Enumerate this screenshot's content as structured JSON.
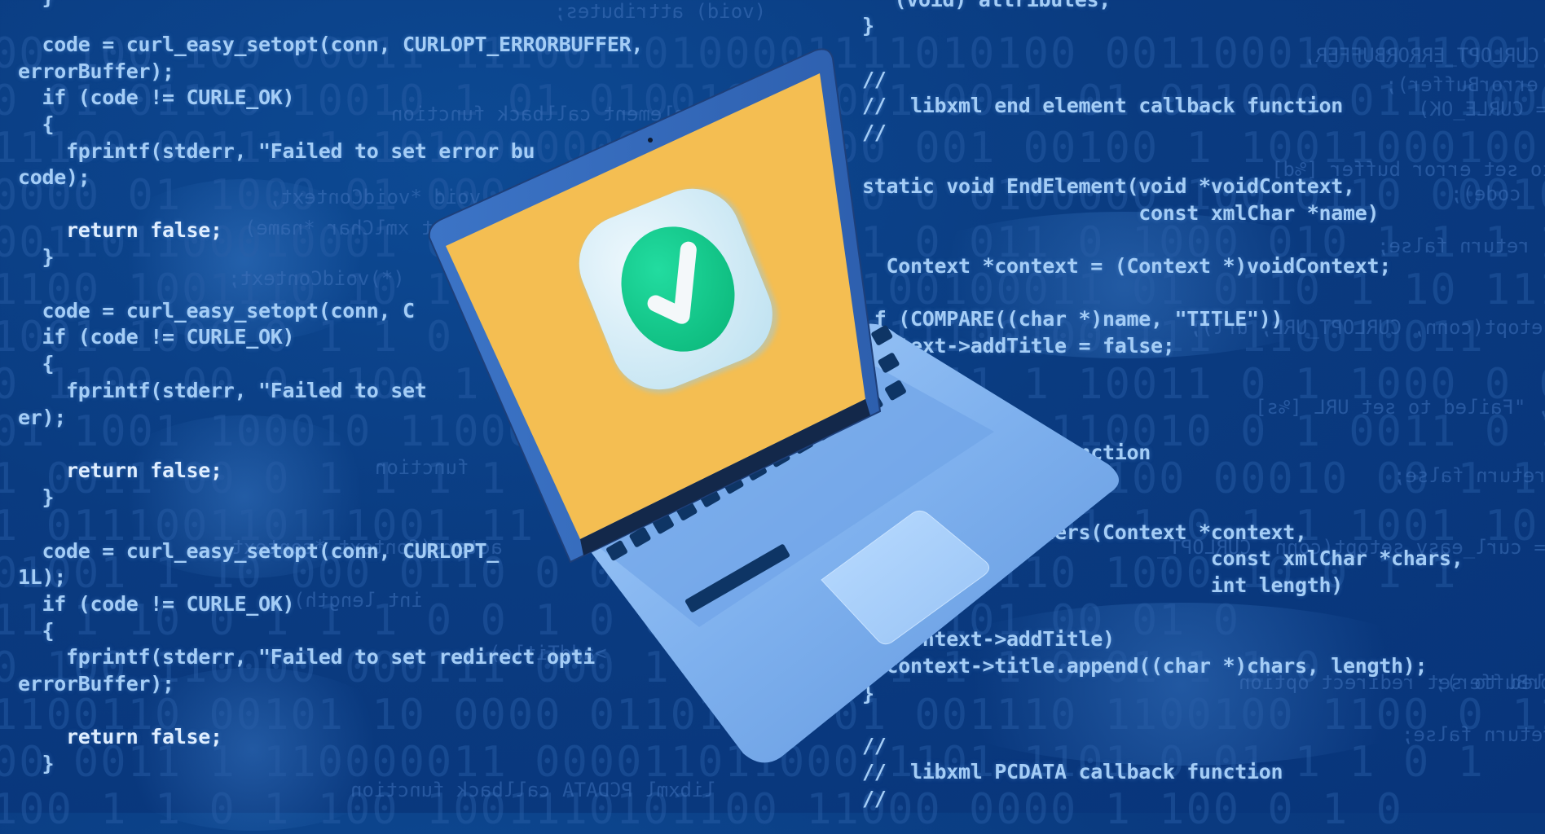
{
  "scene": {
    "title": "Laptop with verified checkmark over source code background",
    "colors": {
      "background": "#0a3b80",
      "code_text": "#a4cdf6",
      "screen": "#f4be52",
      "laptop_body": "#7fb0ec",
      "keyboard_key": "#0e3565",
      "badge_bg": "#cde8f4",
      "check_circle": "#12c98a",
      "check_mark": "#ffffff"
    },
    "icon": "check-circle-icon"
  },
  "code_left": [
    {
      "text": "  }"
    },
    {
      "text": "  code = curl_easy_setopt(conn, CURLOPT_ERRORBUFFER,"
    },
    {
      "text": "errorBuffer);"
    },
    {
      "text": "  if (code != CURLE_OK)"
    },
    {
      "text": "  {"
    },
    {
      "text": "    fprintf(stderr, \"Failed to set error bu"
    },
    {
      "text": "code);"
    },
    {
      "text": "    return false;"
    },
    {
      "text": "  }"
    },
    {
      "text": "  code = curl_easy_setopt(conn, C"
    },
    {
      "text": "  if (code != CURLE_OK)"
    },
    {
      "text": "  {"
    },
    {
      "text": "    fprintf(stderr, \"Failed to set"
    },
    {
      "text": "er);"
    },
    {
      "text": "    return false;"
    },
    {
      "text": "  }"
    },
    {
      "text": "  code = curl_easy_setopt(conn, CURLOPT_"
    },
    {
      "text": "1L);"
    },
    {
      "text": "  if (code != CURLE_OK)"
    },
    {
      "text": "  {"
    },
    {
      "text": "    fprintf(stderr, \"Failed to set redirect opti"
    },
    {
      "text": "errorBuffer);"
    },
    {
      "text": "    return false;"
    },
    {
      "text": "  }"
    }
  ],
  "code_right": [
    {
      "text": "  (void) attributes;"
    },
    {
      "text": "}"
    },
    {
      "text": "//"
    },
    {
      "text": "//  libxml end element callback function"
    },
    {
      "text": "//"
    },
    {
      "text": "static void EndElement(void *voidContext,"
    },
    {
      "text": "                       const xmlChar *name)"
    },
    {
      "text": "  Context *context = (Context *)voidContext;"
    },
    {
      "text": " f (COMPARE((char *)name, \"TITLE\"))"
    },
    {
      "text": "  ntext->addTitle = false;"
    },
    {
      "text": "         helper function"
    },
    {
      "text": "       leCharacters(Context *context,"
    },
    {
      "text": "                             const xmlChar *chars,"
    },
    {
      "text": "                             int length)"
    },
    {
      "text": "  (context->addTitle)"
    },
    {
      "text": "  context->title.append((char *)chars, length);"
    },
    {
      "text": "}"
    },
    {
      "text": "//"
    },
    {
      "text": "//  libxml PCDATA callback function"
    },
    {
      "text": "//"
    }
  ],
  "ghost_text": [
    "(void) attributes;",
    "end element callback function",
    "void *voidContext,",
    "const xmlChar *name)",
    "(*)voidContext;",
    "function",
    "acters(Context *context,",
    "int length)",
    ">addTitle)",
    "libxml PCDATA callback function",
    "code = curl_easy_setopt(conn, CURLOPT_ERRORBUFFER,",
    "errorBuffer);",
    "if (code != CURLE_OK)",
    "fprintf(stderr, \"Failed to set error buffer [%d]",
    "code);",
    "return false;",
    "code = curl_easy_setopt(conn, CURLOPT_URL, url);",
    "fprintf(stderr, \"Failed to set URL [%s]",
    "return false;",
    "code = curl_easy_setopt(conn, CURLOPT_",
    "fprintf(stderr, \"Failed to set redirect option",
    "errorBuffer);",
    "return false;"
  ],
  "binary_rows": [
    "00 100 100 00011 11100110100001111010100 0011000100011001100001 01",
    "0 01 01100 10010 1 01 01001001 001 0011 01 011000 011 10001 0110",
    "11100 00111 1 1010000000101100 00 001 00100 1 10011000100",
    "0000 01 1000 01 000 001 0001100 0 0 0100000 100 0110 00010 0 01",
    "001101100010001 0 1 01000 1 001 1 0 011 0 1000 010 1 1 1 1100",
    "1100 1001110 10 1100 0 1001 0 1 100100011 01 0110 1 10 1110 10",
    "1001 1000 0 1 1 0 0 100 0 1100 00111001001111 110010011",
    "0 1100 00 0 1100 1 1 01 1000 1 00 011 1 10011 0 1 1000 0 0011",
    "01 1001 100010 1100000 110 0 1110 1 10 110010 0 1 0011 0 1 01",
    "1 0011 00 0 1 1 1 1 0000 111000 11 1 0 1 100 00010 00 1 1",
    "1 011100110111001 11 1 1 1010 110 0 10 01 1 0 1 1 1001 10",
    "01001 1 10 000 0110 0 00 1 1 0 000001110 1000 10 0 1 1",
    "11 1 10 0 1 1 1 0 0 1 0 0100110001 101 00 01 0",
    "0 100 110000 000111 000 1 11 0 1 1 1 1 0 01 1 1 0",
    "1100110 00101 10 0000 01101110 01 001110 1100100 1100 0 11 11",
    "00 0011 1 110000011 00001101100011101 1101 0 01 1 1 0 1",
    "100 1 1 0 1 100 1001110101100 11000 0000 1 100 0 1 0"
  ]
}
